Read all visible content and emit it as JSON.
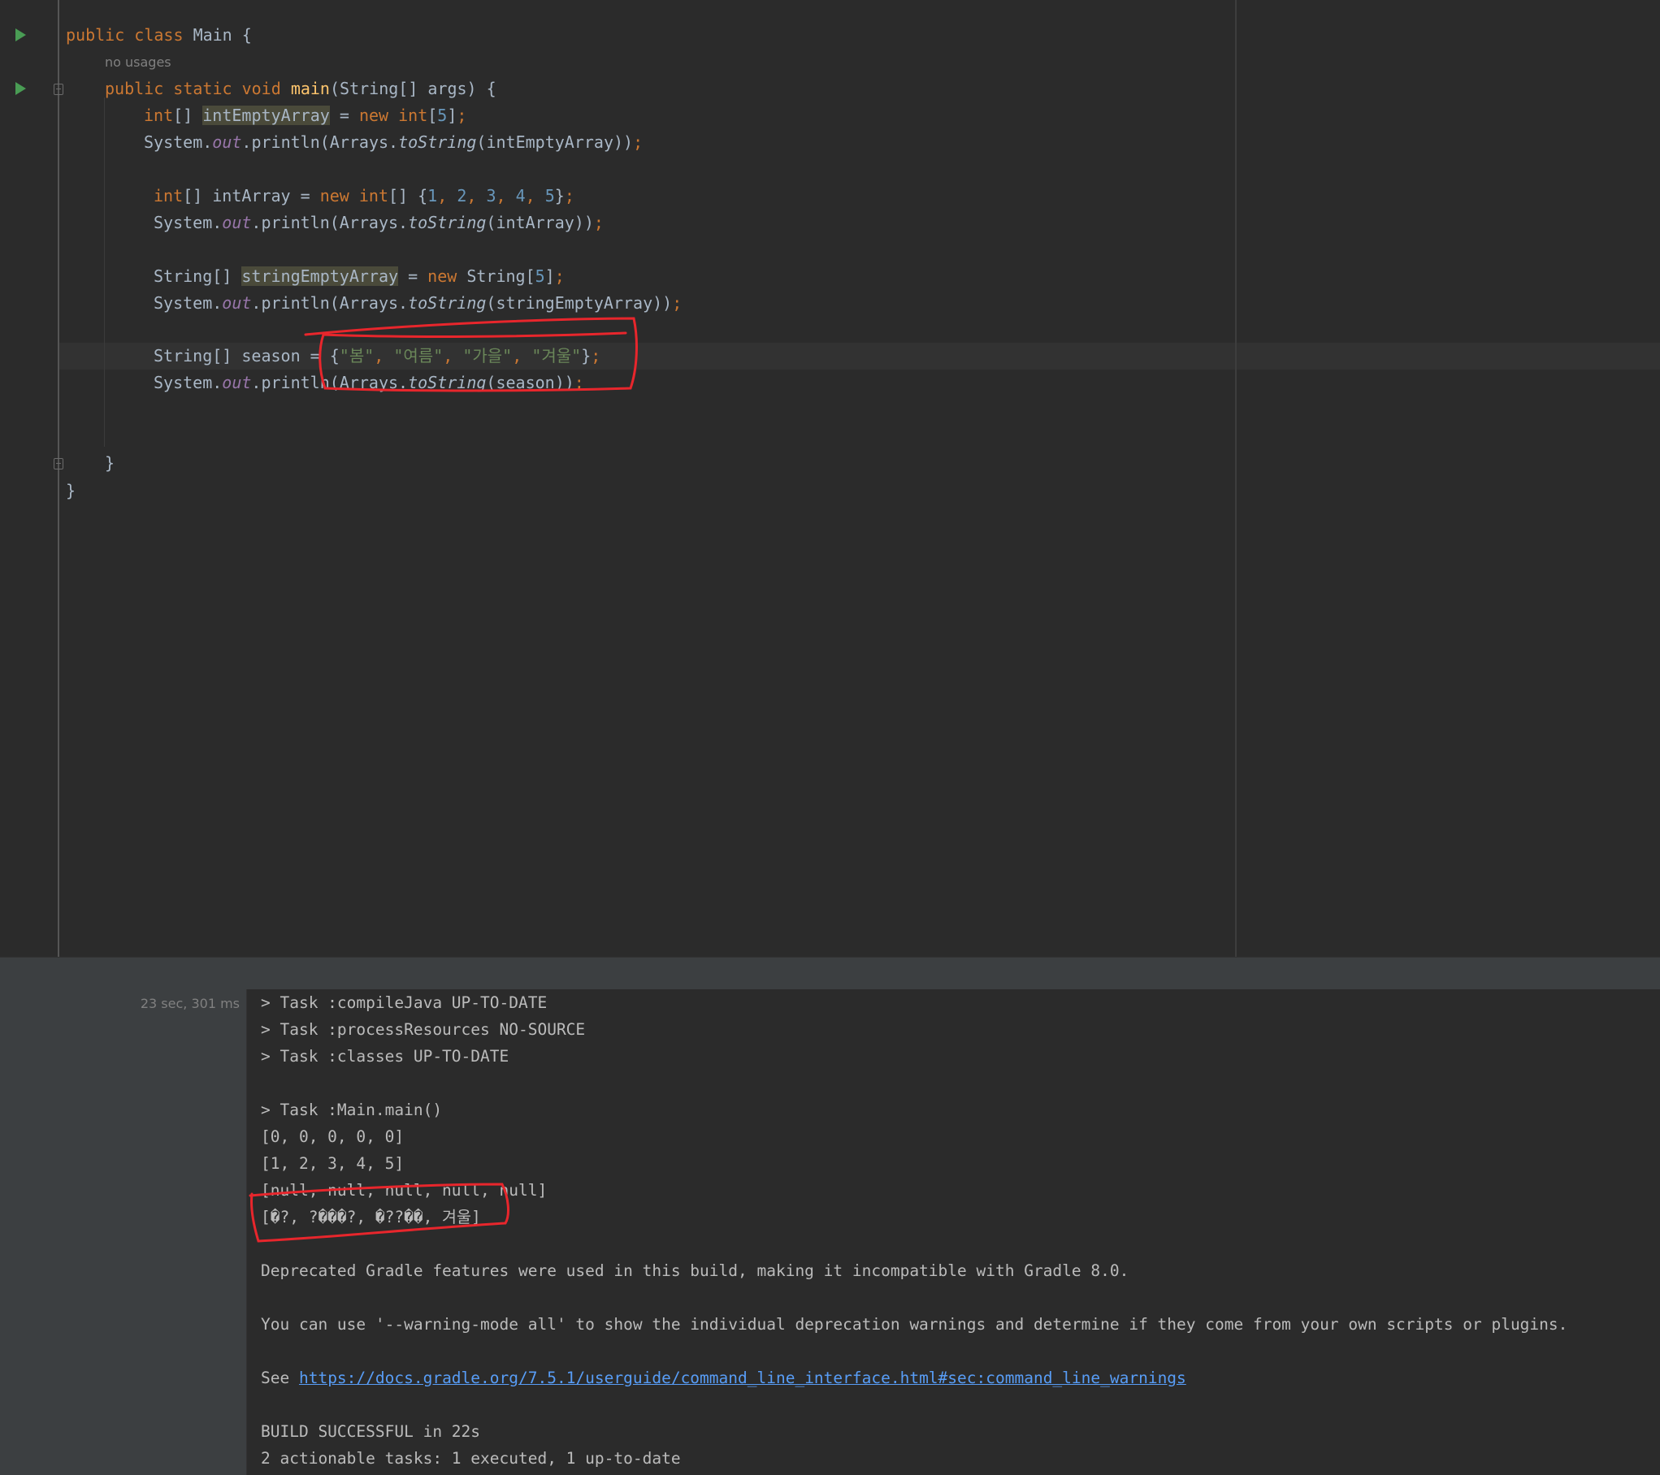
{
  "editor": {
    "hint_no_usages": "no usages",
    "lines": {
      "l1": {
        "kw1": "public",
        "kw2": "class",
        "name": "Main",
        "brace": "{"
      },
      "l2": {
        "kw1": "public",
        "kw2": "static",
        "kw3": "void",
        "fn": "main",
        "rest": "(String[] args) {"
      },
      "l3": {
        "kw": "int",
        "arr": "[]",
        "var": "intEmptyArray",
        "eq": " = ",
        "kw2": "new",
        "kw3": "int",
        "b1": "[",
        "num": "5",
        "b2": "]",
        "semi": ";"
      },
      "l4": {
        "a": "System.",
        "field": "out",
        "b": ".println(Arrays.",
        "m": "toString",
        "c": "(intEmptyArray))",
        "semi": ";"
      },
      "l5": {
        "kw": "int",
        "a": "[] intArray = ",
        "kw2": "new",
        "kw3": "int",
        "b": "[] {",
        "n1": "1",
        "n2": "2",
        "n3": "3",
        "n4": "4",
        "n5": "5",
        "comma": ", ",
        "end": "}",
        "semi": ";"
      },
      "l6": {
        "a": "System.",
        "field": "out",
        "b": ".println(Arrays.",
        "m": "toString",
        "c": "(intArray))",
        "semi": ";"
      },
      "l7": {
        "a": "String[] ",
        "var": "stringEmptyArray",
        "eq": " = ",
        "kw": "new",
        "b": " String[",
        "num": "5",
        "c": "]",
        "semi": ";"
      },
      "l8": {
        "a": "System.",
        "field": "out",
        "b": ".println(Arrays.",
        "m": "toString",
        "c": "(stringEmptyArray))",
        "semi": ";"
      },
      "l9": {
        "a": "String[] season = {",
        "s1": "\"봄\"",
        "s2": "\"여름\"",
        "s3": "\"가을\"",
        "s4": "\"겨울\"",
        "comma": ", ",
        "end": "}",
        "semi": ";"
      },
      "l10": {
        "a": "System.",
        "field": "out",
        "b": ".println(Arrays.",
        "m": "toString",
        "c": "(season))",
        "semi": ";"
      },
      "l11": {
        "brace": "}"
      },
      "l12": {
        "brace": "}"
      }
    }
  },
  "console": {
    "duration": "23 sec, 301 ms",
    "lines": [
      "> Task :compileJava UP-TO-DATE",
      "> Task :processResources NO-SOURCE",
      "> Task :classes UP-TO-DATE",
      "",
      "> Task :Main.main()",
      "[0, 0, 0, 0, 0]",
      "[1, 2, 3, 4, 5]",
      "[null, null, null, null, null]",
      "[�?, ?���?, �??��, 겨울]",
      "",
      "Deprecated Gradle features were used in this build, making it incompatible with Gradle 8.0.",
      "",
      "You can use '--warning-mode all' to show the individual deprecation warnings and determine if they come from your own scripts or plugins.",
      "",
      "",
      "",
      "BUILD SUCCESSFUL in 22s",
      "2 actionable tasks: 1 executed, 1 up-to-date"
    ],
    "see_prefix": "See ",
    "see_link": "https://docs.gradle.org/7.5.1/userguide/command_line_interface.html#sec:command_line_warnings"
  },
  "colors": {
    "keyword": "#cc7832",
    "number": "#6897bb",
    "string": "#6a8759",
    "field": "#9876aa",
    "annotation": "#e8262c"
  }
}
